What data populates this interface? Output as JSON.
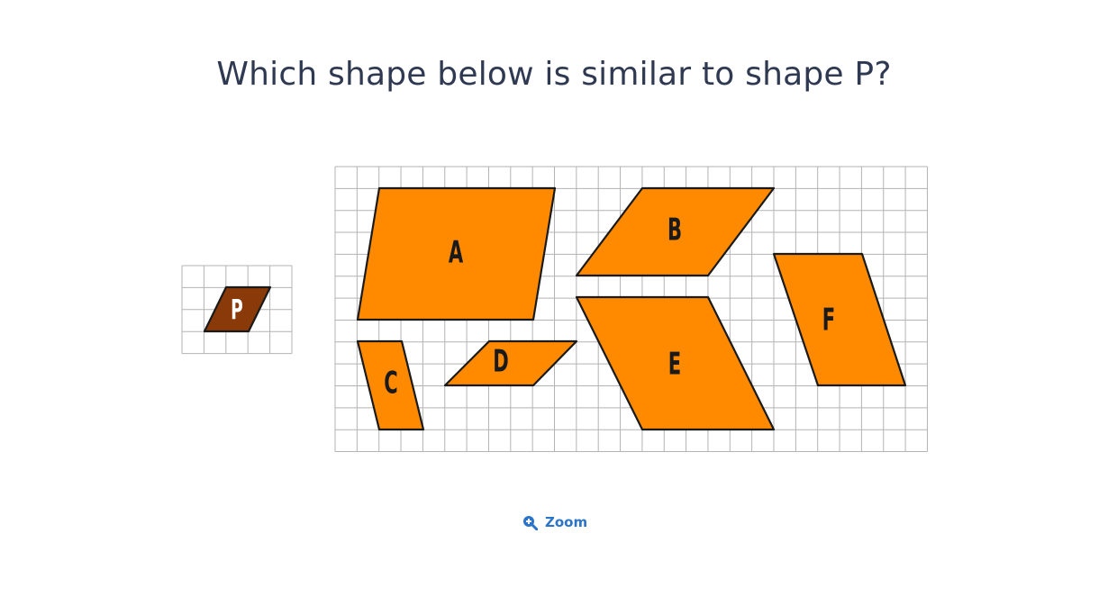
{
  "question": "Which shape below is similar to shape P?",
  "zoom": {
    "label": "Zoom",
    "icon": "zoom-in-icon"
  },
  "colors": {
    "shape_p_fill": "#8a3a08",
    "shape_fill": "#ff8a00",
    "outline": "#1a1a1a",
    "grid_line": "#b3b3b3",
    "label_p": "#ffffff",
    "label": "#1a1a1a",
    "link": "#2b74c7"
  },
  "shapes": [
    {
      "id": "P",
      "label": "P"
    },
    {
      "id": "A",
      "label": "A"
    },
    {
      "id": "B",
      "label": "B"
    },
    {
      "id": "C",
      "label": "C"
    },
    {
      "id": "D",
      "label": "D"
    },
    {
      "id": "E",
      "label": "E"
    },
    {
      "id": "F",
      "label": "F"
    }
  ]
}
